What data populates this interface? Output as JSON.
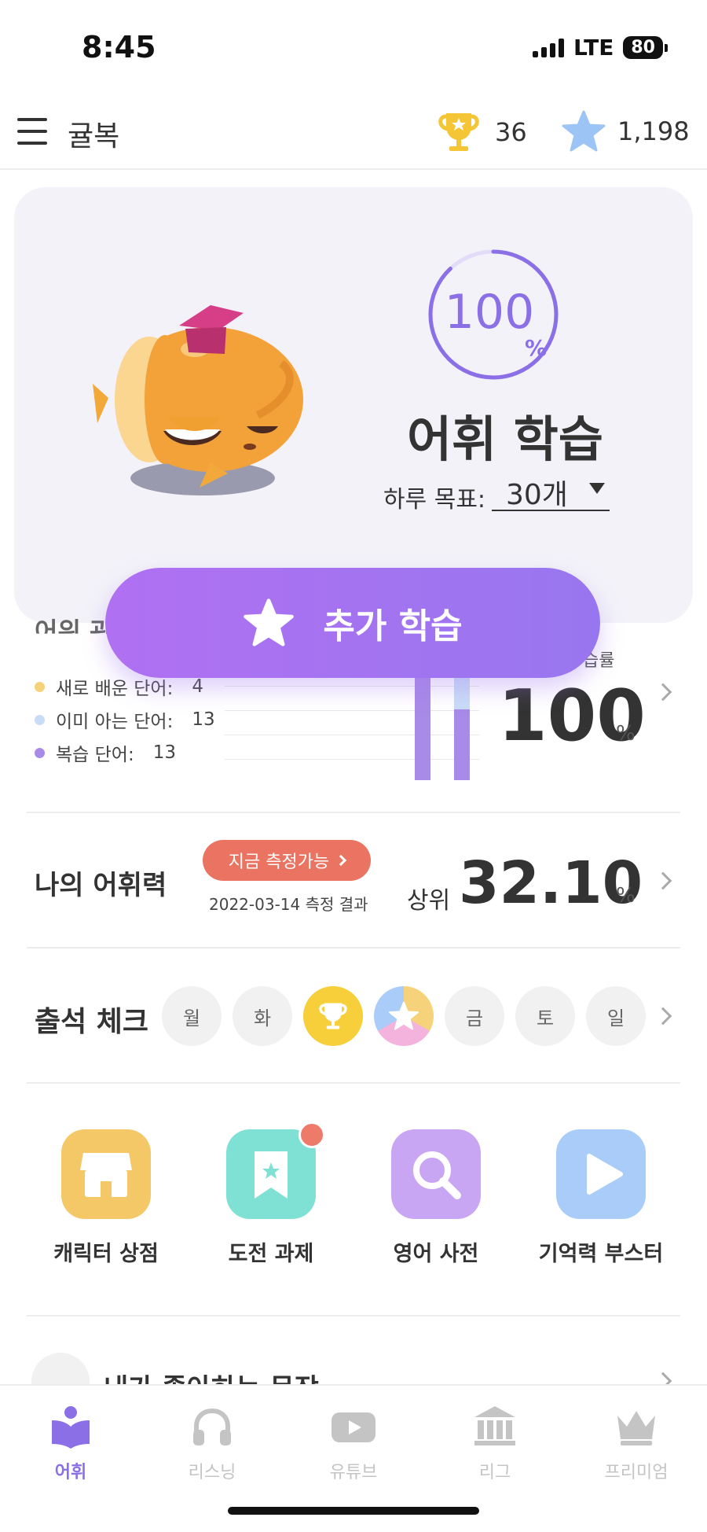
{
  "status": {
    "time": "8:45",
    "network": "LTE",
    "battery": "80"
  },
  "header": {
    "title": "귤복",
    "trophies": "36",
    "stars": "1,198"
  },
  "hero": {
    "progress_value": "100",
    "progress_unit": "%",
    "progress_fraction": 1.0,
    "title": "어휘 학습",
    "goal_label": "하루 목표:",
    "goal_value": "30개"
  },
  "extra_study": {
    "label": "추가 학습"
  },
  "vocab": {
    "partial_title": "어위 관",
    "legend": [
      {
        "label": "새로 배운 단어:",
        "value": "4",
        "color": "#f6d27a"
      },
      {
        "label": "이미 아는 단어:",
        "value": "13",
        "color": "#c9dcf6"
      },
      {
        "label": "복습 단어:",
        "value": "13",
        "color": "#a88ae8"
      }
    ],
    "rate_label": "습률",
    "rate_value": "100",
    "rate_unit": "%"
  },
  "level": {
    "label": "나의 어휘력",
    "measure_button": "지금 측정가능",
    "measure_date": "2022-03-14 측정 결과",
    "rank_label": "상위",
    "rank_value": "32.10",
    "rank_unit": "%"
  },
  "attendance": {
    "label": "출석 체크",
    "days": [
      "월",
      "화",
      "",
      "",
      "금",
      "토",
      "일"
    ]
  },
  "menu": [
    {
      "label": "캐릭터 상점",
      "icon": "store-icon",
      "color": "#f5c867"
    },
    {
      "label": "도전 과제",
      "icon": "bookmark-star-icon",
      "color": "#7fe1d3"
    },
    {
      "label": "영어 사전",
      "icon": "magnifier-icon",
      "color": "#c9a6f3"
    },
    {
      "label": "기억력 부스터",
      "icon": "play-icon",
      "color": "#a9cdf8"
    }
  ],
  "favorites": {
    "label": "내가 좋아하는 문장"
  },
  "tabs": [
    {
      "label": "어휘",
      "icon": "book-icon",
      "active": true
    },
    {
      "label": "리스닝",
      "icon": "headphones-icon",
      "active": false
    },
    {
      "label": "유튜브",
      "icon": "youtube-icon",
      "active": false
    },
    {
      "label": "리그",
      "icon": "bank-icon",
      "active": false
    },
    {
      "label": "프리미엄",
      "icon": "crown-icon",
      "active": false
    }
  ],
  "colors": {
    "accent": "#8b6fe6",
    "measure": "#ea7461",
    "gold": "#f4c534"
  }
}
